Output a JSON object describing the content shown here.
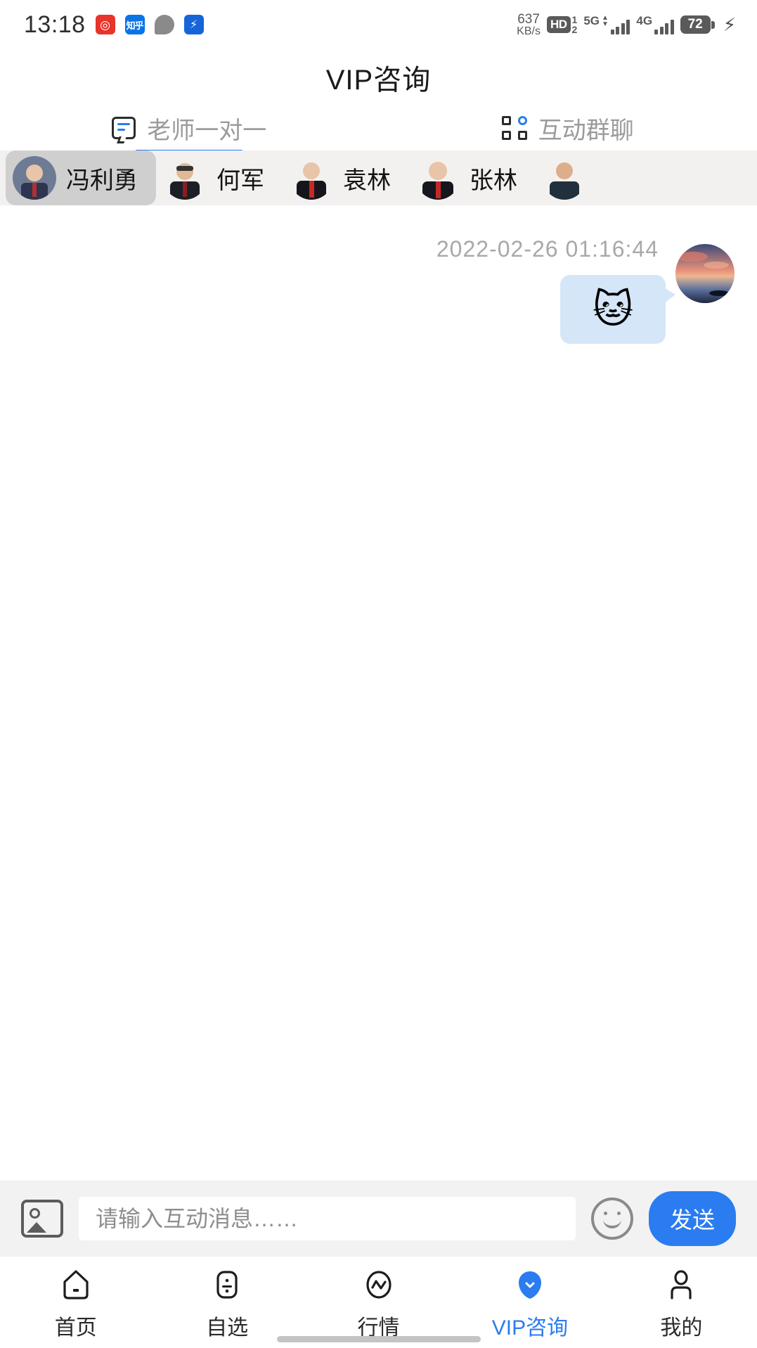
{
  "status_bar": {
    "time": "13:18",
    "app_icons": [
      {
        "name": "netease-music-icon",
        "glyph": "◎"
      },
      {
        "name": "zhihu-icon",
        "glyph": "知乎"
      },
      {
        "name": "message-bubble-icon",
        "glyph": ""
      },
      {
        "name": "flash-app-icon",
        "glyph": "⚡"
      }
    ],
    "network_speed_value": "637",
    "network_speed_unit": "KB/s",
    "hd_label": "HD",
    "hd_sim_top": "1",
    "hd_sim_bottom": "2",
    "signal_1_label": "5G",
    "signal_2_label": "4G",
    "battery_level": "72",
    "charging_glyph": "⚡"
  },
  "header": {
    "title": "VIP咨询"
  },
  "tabs": [
    {
      "label": "老师一对一",
      "icon": "one-to-one-chat-icon",
      "active": true
    },
    {
      "label": "互动群聊",
      "icon": "group-chat-icon",
      "active": false
    }
  ],
  "teachers": [
    {
      "name": "冯利勇",
      "selected": true
    },
    {
      "name": "何军",
      "selected": false
    },
    {
      "name": "袁林",
      "selected": false
    },
    {
      "name": "张林",
      "selected": false
    },
    {
      "name": "",
      "selected": false
    }
  ],
  "chat": {
    "messages": [
      {
        "timestamp": "2022-02-26 01:16:44",
        "content": "🐱",
        "type": "emoji",
        "side": "right",
        "avatar": "sunset-lake-photo"
      }
    ]
  },
  "input_bar": {
    "image_button": "image-picker-icon",
    "placeholder": "请输入互动消息……",
    "value": "",
    "emoji_button": "emoji-smiley-icon",
    "send_label": "发送"
  },
  "bottom_nav": [
    {
      "label": "首页",
      "icon": "home-icon",
      "active": false
    },
    {
      "label": "自选",
      "icon": "watchlist-icon",
      "active": false
    },
    {
      "label": "行情",
      "icon": "quotes-icon",
      "active": false
    },
    {
      "label": "VIP咨询",
      "icon": "vip-consult-icon",
      "active": true
    },
    {
      "label": "我的",
      "icon": "profile-icon",
      "active": false
    }
  ],
  "colors": {
    "accent": "#2b7cf0",
    "bubble": "#d6e6f9",
    "strip_bg": "#f3f1ef",
    "input_bg": "#f2f2f2"
  }
}
